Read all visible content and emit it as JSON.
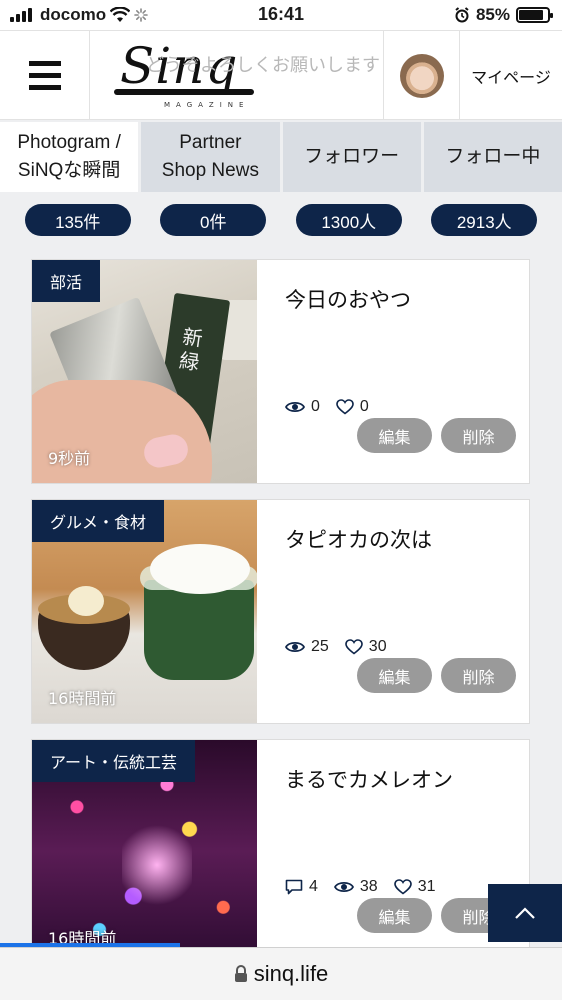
{
  "status_bar": {
    "carrier": "docomo",
    "time": "16:41",
    "battery": "85%",
    "battery_level": 0.85
  },
  "header": {
    "logo_text": "Sinq",
    "logo_sub": "MAGAZINE",
    "marquee": "どうぞよろしくお願いします",
    "mypage_label": "マイページ"
  },
  "tabs": [
    {
      "line1": "Photogram /",
      "line2": "SiNQな瞬間",
      "active": true
    },
    {
      "line1": "Partner",
      "line2": "Shop News",
      "active": false
    },
    {
      "line1": "フォロワー",
      "line2": "",
      "active": false
    },
    {
      "line1": "フォロー中",
      "line2": "",
      "active": false
    }
  ],
  "counts": [
    "135件",
    "0件",
    "1300人",
    "2913人"
  ],
  "posts": [
    {
      "category": "部活",
      "ago": "9秒前",
      "title": "今日のおやつ",
      "views": "0",
      "likes": "0",
      "comments": null,
      "photo_text": "新緑",
      "edit_label": "編集",
      "delete_label": "削除"
    },
    {
      "category": "グルメ・食材",
      "ago": "16時間前",
      "title": "タピオカの次は",
      "views": "25",
      "likes": "30",
      "comments": null,
      "edit_label": "編集",
      "delete_label": "削除"
    },
    {
      "category": "アート・伝統工芸",
      "ago": "16時間前",
      "title": "まるでカメレオン",
      "views": "38",
      "likes": "31",
      "comments": "4",
      "edit_label": "編集",
      "delete_label": "削除"
    }
  ],
  "url": "sinq.life",
  "colors": {
    "navy": "#0e2549",
    "tab_inactive": "#d9dde3",
    "button_gray": "#9a9a9a",
    "page_bg": "#eeeff1"
  },
  "icons": [
    "signal-icon",
    "wifi-icon",
    "loading-icon",
    "alarm-icon",
    "battery-icon",
    "menu-icon",
    "eye-icon",
    "heart-icon",
    "comment-icon",
    "chevron-up-icon",
    "lock-icon"
  ]
}
